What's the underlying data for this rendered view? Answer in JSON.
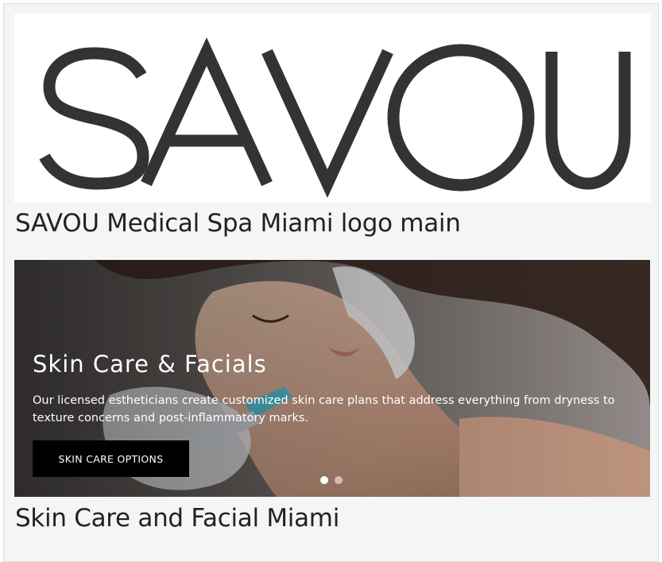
{
  "logo": {
    "wordmark": "SAVOU",
    "wordmark_color": "#333333",
    "background": "#ffffff",
    "caption": "SAVOU Medical Spa Miami logo main"
  },
  "hero": {
    "title": "Skin Care & Facials",
    "description": "Our licensed estheticians create customized skin care plans that address everything from dryness to texture concerns and post-inflammatory marks.",
    "button_label": "SKIN CARE OPTIONS",
    "slides": [
      {
        "active": true
      },
      {
        "active": false
      }
    ],
    "caption": "Skin Care and Facial Miami"
  },
  "colors": {
    "page_background": "#f5f5f5",
    "button_background": "#000000",
    "button_text": "#ffffff"
  }
}
